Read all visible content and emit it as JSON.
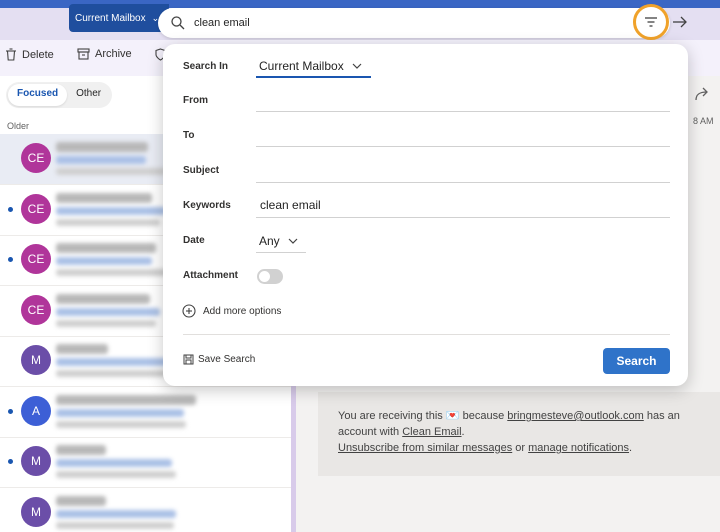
{
  "topbar": {
    "mailbox_label": "Current Mailbox",
    "search_text": "clean email"
  },
  "toolbar": {
    "delete_label": "Delete",
    "archive_label": "Archive"
  },
  "list": {
    "tab_focused": "Focused",
    "tab_other": "Other",
    "group_label": "Older",
    "rows": [
      {
        "initials": "CE",
        "color": "#b0359a",
        "unread": false,
        "selected": true
      },
      {
        "initials": "CE",
        "color": "#b0359a",
        "unread": true,
        "selected": false
      },
      {
        "initials": "CE",
        "color": "#b0359a",
        "unread": true,
        "selected": false
      },
      {
        "initials": "CE",
        "color": "#b0359a",
        "unread": false,
        "selected": false
      },
      {
        "initials": "M",
        "color": "#6b4ea8",
        "unread": false,
        "selected": false
      },
      {
        "initials": "A",
        "color": "#3d5fd6",
        "unread": true,
        "selected": false
      },
      {
        "initials": "M",
        "color": "#6b4ea8",
        "unread": true,
        "selected": false
      },
      {
        "initials": "M",
        "color": "#6b4ea8",
        "unread": false,
        "selected": false
      }
    ]
  },
  "reading": {
    "time_fragment": "8 AM",
    "footer_line1_pre": "You are receiving this",
    "footer_line1_mid": "because",
    "footer_email": "bringmesteve@outlook.com",
    "footer_line1_post": "has an",
    "footer_line2_pre": "account with",
    "footer_link_clean": "Clean Email",
    "footer_link_unsub": "Unsubscribe from similar messages",
    "footer_or": "or",
    "footer_link_manage": "manage notifications"
  },
  "popup": {
    "search_in_label": "Search In",
    "search_in_value": "Current Mailbox",
    "from_label": "From",
    "to_label": "To",
    "subject_label": "Subject",
    "keywords_label": "Keywords",
    "keywords_value": "clean email",
    "date_label": "Date",
    "date_value": "Any",
    "attachment_label": "Attachment",
    "attachment_on": false,
    "add_more_label": "Add more options",
    "save_search_label": "Save Search",
    "search_button_label": "Search"
  },
  "colors": {
    "accent": "#2f73c9",
    "highlight_ring": "#f0a22a"
  }
}
